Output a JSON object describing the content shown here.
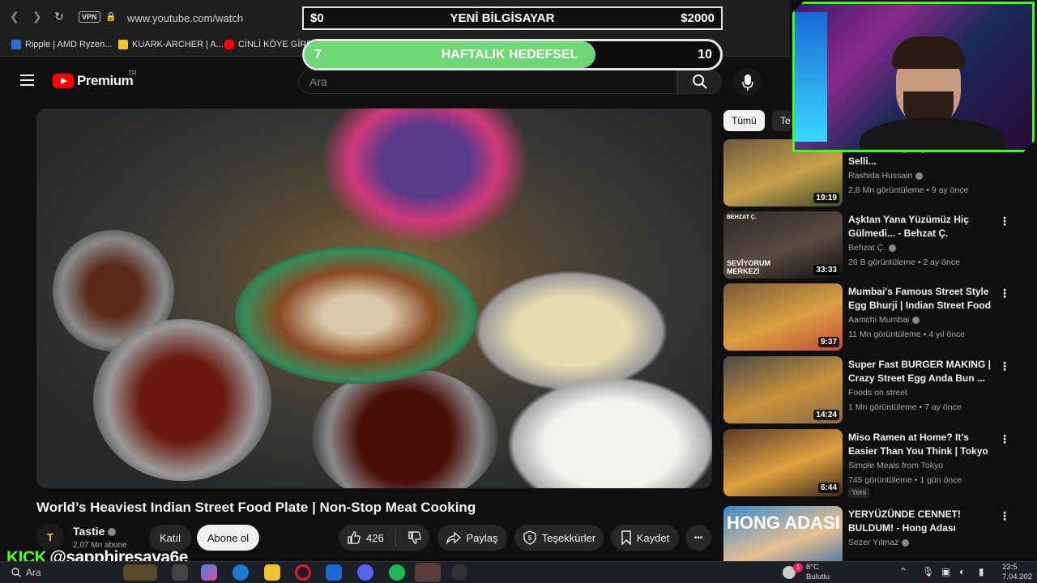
{
  "browser": {
    "url": "www.youtube.com/watch",
    "vpn_label": "VPN",
    "bookmarks": [
      {
        "label": "Ripple | AMD Ryzen...",
        "color": "#2f6bd6"
      },
      {
        "label": "KUARK-ARCHER | A...",
        "color": "#f2c230"
      },
      {
        "label": "CİNLİ KÖYE GİRDİ",
        "color": "#ff0000"
      }
    ]
  },
  "overlay": {
    "goal1": {
      "left": "$0",
      "title": "YENİ BİLGİSAYAR",
      "right": "$2000"
    },
    "goal2": {
      "left": "7",
      "title": "HAFTALIK HEDEFSEL",
      "right": "10",
      "progress": 0.7
    },
    "kick_logo": "KICK",
    "kick_handle": "@sapphiresava6e"
  },
  "youtube": {
    "logo_text": "Premium",
    "logo_region": "TR",
    "search_placeholder": "Ara",
    "video": {
      "title": "World’s Heaviest Indian Street Food Plate | Non-Stop Meat Cooking",
      "channel": "Tastie",
      "channel_avatar": "T",
      "subscribers": "2,07 Mn abone",
      "join_label": "Katıl",
      "subscribe_label": "Abone ol",
      "likes": "426",
      "share_label": "Paylaş",
      "thanks_label": "Teşekkürler",
      "save_label": "Kaydet",
      "more_label": "•••"
    },
    "chips": [
      "Tümü",
      "Te"
    ],
    "recommendations": [
      {
        "title": "Hardworking Afghani Kid Selli...",
        "channel": "Rashida Hussain",
        "verified": true,
        "meta": "2,8 Mn görüntüleme • 9 ay önce",
        "duration": "19:19",
        "thumb_colors": [
          "#6b5a3c",
          "#c8a04a",
          "#3d4a2a"
        ],
        "badge": ""
      },
      {
        "title": "Aşktan Yana Yüzümüz Hiç Gülmedi... - Behzat Ç.",
        "channel": "Behzat Ç.",
        "verified": true,
        "meta": "26 B görüntüleme • 2 ay önce",
        "duration": "33:33",
        "thumb_colors": [
          "#2a2a2a",
          "#5a4a40",
          "#111111"
        ],
        "badge": "",
        "thumb_label": "SEVİYORUM MERKEZİ",
        "thumb_tag": "BEHZAT Ç."
      },
      {
        "title": "Mumbai's Famous Street Style Egg Bhurji | Indian Street Food",
        "channel": "Aamchi Mumbai",
        "verified": true,
        "meta": "11 Mn görüntüleme • 4 yıl önce",
        "duration": "9:37",
        "thumb_colors": [
          "#7a5a3a",
          "#d9a040",
          "#c44a3a"
        ],
        "badge": ""
      },
      {
        "title": "Super Fast BURGER MAKING | Crazy Street Egg Anda Bun ...",
        "channel": "Foods on street",
        "verified": false,
        "meta": "1 Mn görüntüleme • 7 ay önce",
        "duration": "14:24",
        "thumb_colors": [
          "#4a4a4a",
          "#c8903a",
          "#8a6a4a"
        ],
        "badge": ""
      },
      {
        "title": "Miso Ramen at Home? It’s Easier Than You Think | Tokyo",
        "channel": "Simple Meals from Tokyo",
        "verified": false,
        "meta": "745 görüntüleme • 1 gün önce",
        "duration": "6:44",
        "thumb_colors": [
          "#5a3a2a",
          "#e0a040",
          "#3a2a1a"
        ],
        "badge": "Yeni"
      },
      {
        "title": "YERYÜZÜNDE CENNET! BULDUM! - Hong Adası",
        "channel": "Sezer Yılmaz",
        "verified": true,
        "meta": "",
        "duration": "",
        "thumb_colors": [
          "#3a8ac8",
          "#e8c090",
          "#2a6aa8"
        ],
        "badge": "",
        "thumb_label": "HONG ADASI"
      }
    ]
  },
  "taskbar": {
    "search_label": "Ara",
    "weather_temp": "8°C",
    "weather_desc": "Bulutlu",
    "time": "23:5",
    "date": "7.04.202",
    "notification_count": "1"
  },
  "colors": {
    "accent_green": "#39ff14",
    "goal_fill": "#6fd775",
    "yt_red": "#ff0000"
  }
}
